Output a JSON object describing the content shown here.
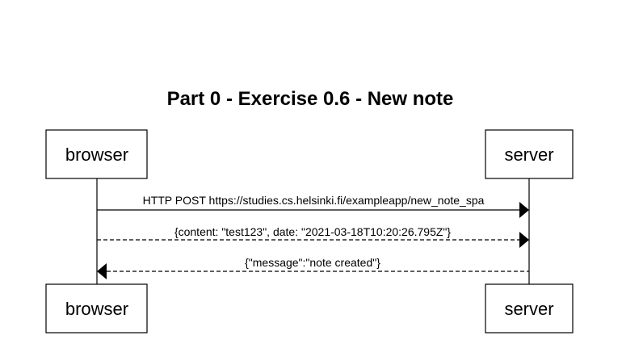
{
  "diagram": {
    "title": "Part 0 - Exercise 0.6 - New note",
    "participants": {
      "browser": "browser",
      "server": "server"
    },
    "messages": [
      {
        "from": "browser",
        "to": "server",
        "style": "solid",
        "label": "HTTP POST https://studies.cs.helsinki.fi/exampleapp/new_note_spa"
      },
      {
        "from": "browser",
        "to": "server",
        "style": "dashed",
        "label": "{content: \"test123\", date: \"2021-03-18T10:20:26.795Z\"}"
      },
      {
        "from": "server",
        "to": "browser",
        "style": "dashed",
        "label": "{\"message\":\"note created\"}"
      }
    ]
  }
}
